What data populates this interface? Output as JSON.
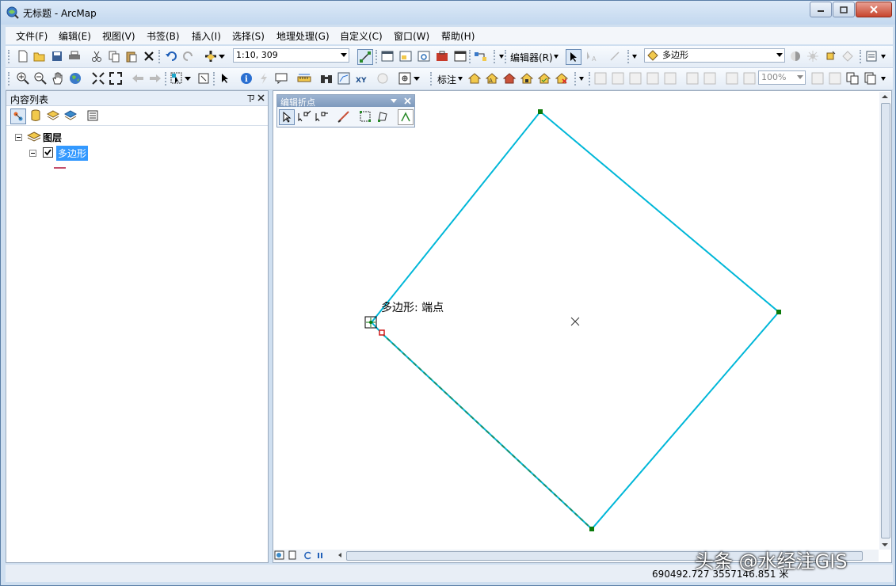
{
  "window": {
    "title": "无标题 - ArcMap"
  },
  "menu": [
    "文件(F)",
    "编辑(E)",
    "视图(V)",
    "书签(B)",
    "插入(I)",
    "选择(S)",
    "地理处理(G)",
    "自定义(C)",
    "窗口(W)",
    "帮助(H)"
  ],
  "toolbar": {
    "scale": "1:10, 309",
    "editor_label": "编辑器(R)",
    "target_layer": "多边形",
    "label_menu": "标注",
    "zoom_percent": "100%"
  },
  "toc": {
    "title": "内容列表",
    "pin": "ㄗ",
    "root": "图层",
    "layer": "多边形",
    "layer_checked": true
  },
  "edit_vertices": {
    "title": "编辑折点"
  },
  "map": {
    "snap_tip": "多边形: 端点",
    "polygon_color": "#00b7d8",
    "vertex_color": "#0a7a0a"
  },
  "status": {
    "coordinates": "690492.727  3557146.851 米"
  },
  "watermark": "头条 @水经注GIS"
}
